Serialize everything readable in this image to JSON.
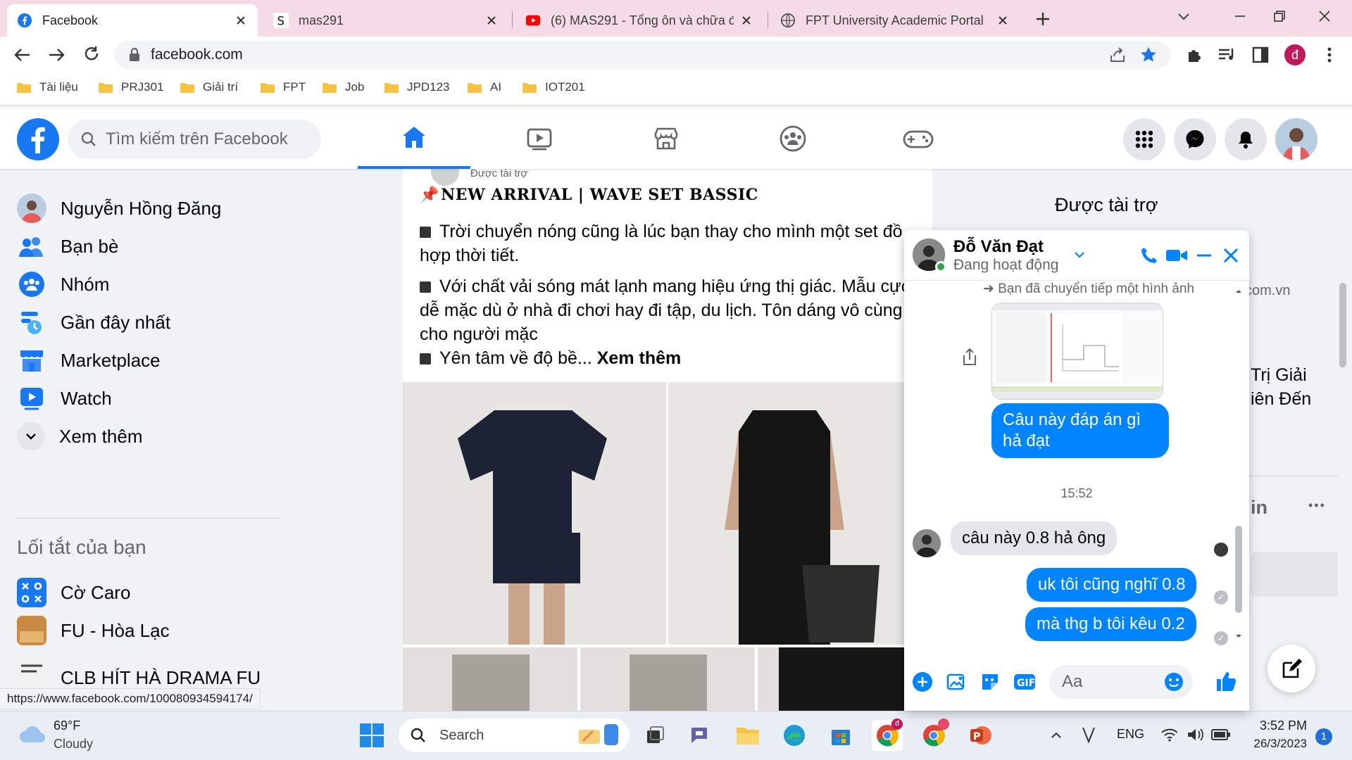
{
  "browser": {
    "tabs": [
      {
        "title": "Facebook",
        "active": true
      },
      {
        "title": "mas291",
        "active": false
      },
      {
        "title": "(6) MAS291 - Tổng ôn và chữa đề",
        "active": false
      },
      {
        "title": "FPT University Academic Portal",
        "active": false
      }
    ],
    "url": "facebook.com",
    "profile_initial": "đ",
    "bookmarks": [
      "Tài liệu",
      "PRJ301",
      "Giải trí",
      "FPT",
      "Job",
      "JPD123",
      "AI",
      "IOT201"
    ]
  },
  "facebook": {
    "search_placeholder": "Tìm kiếm trên Facebook",
    "brand_color": "#1877f2",
    "left_nav": {
      "user_name": "Nguyễn Hồng Đăng",
      "items": [
        "Bạn bè",
        "Nhóm",
        "Gần đây nhất",
        "Marketplace",
        "Watch",
        "Xem thêm"
      ],
      "shortcuts_title": "Lối tắt của bạn",
      "shortcuts": [
        "Cờ Caro",
        "FU - Hòa Lạc",
        "CLB HÍT HÀ DRAMA FU"
      ]
    },
    "post": {
      "sponsored_label": "Được tài trợ",
      "headline": "NEW ARRIVAL | WAVE SET BASSIC",
      "para1": "Trời chuyển nóng cũng là lúc bạn thay cho mình một set đồ hợp thời tiết.",
      "para2": "Với chất vải sóng mát lạnh mang hiệu ứng thị giác. Mẫu cực dễ mặc dù ở nhà đi chơi hay đi tập, du lịch. Tôn dáng vô cùng cho người mặc",
      "para3": "Yên tâm về độ bề...",
      "see_more": "Xem thêm"
    },
    "right_col": {
      "sponsored_title": "Được tài trợ",
      "ad_domain_fragment": "com.vn",
      "ad_text_1": "Trị Giải",
      "ad_text_2": "iên Đến",
      "contacts_fragment": "in",
      "more": "•••"
    },
    "chat": {
      "contact_name": "Đỗ Văn Đạt",
      "status": "Đang hoạt động",
      "forwarded_note": "Bạn đã chuyển tiếp một hình ảnh",
      "messages": [
        {
          "from": "me",
          "text": "Câu này đáp án gì hả đạt"
        },
        {
          "from": "them",
          "text": "câu này 0.8 hả ông"
        },
        {
          "from": "me",
          "text": "uk tôi cũng nghĩ 0.8"
        },
        {
          "from": "me",
          "text": "mà thg b tôi kêu 0.2"
        }
      ],
      "timestamp": "15:52",
      "input_placeholder": "Aa",
      "online_color": "#31a24c"
    }
  },
  "status_url": "https://www.facebook.com/100080934594174/",
  "taskbar": {
    "weather_temp": "69°F",
    "weather_desc": "Cloudy",
    "search_label": "Search",
    "language": "ENG",
    "time": "3:52 PM",
    "date": "26/3/2023",
    "notification_count": "1"
  }
}
